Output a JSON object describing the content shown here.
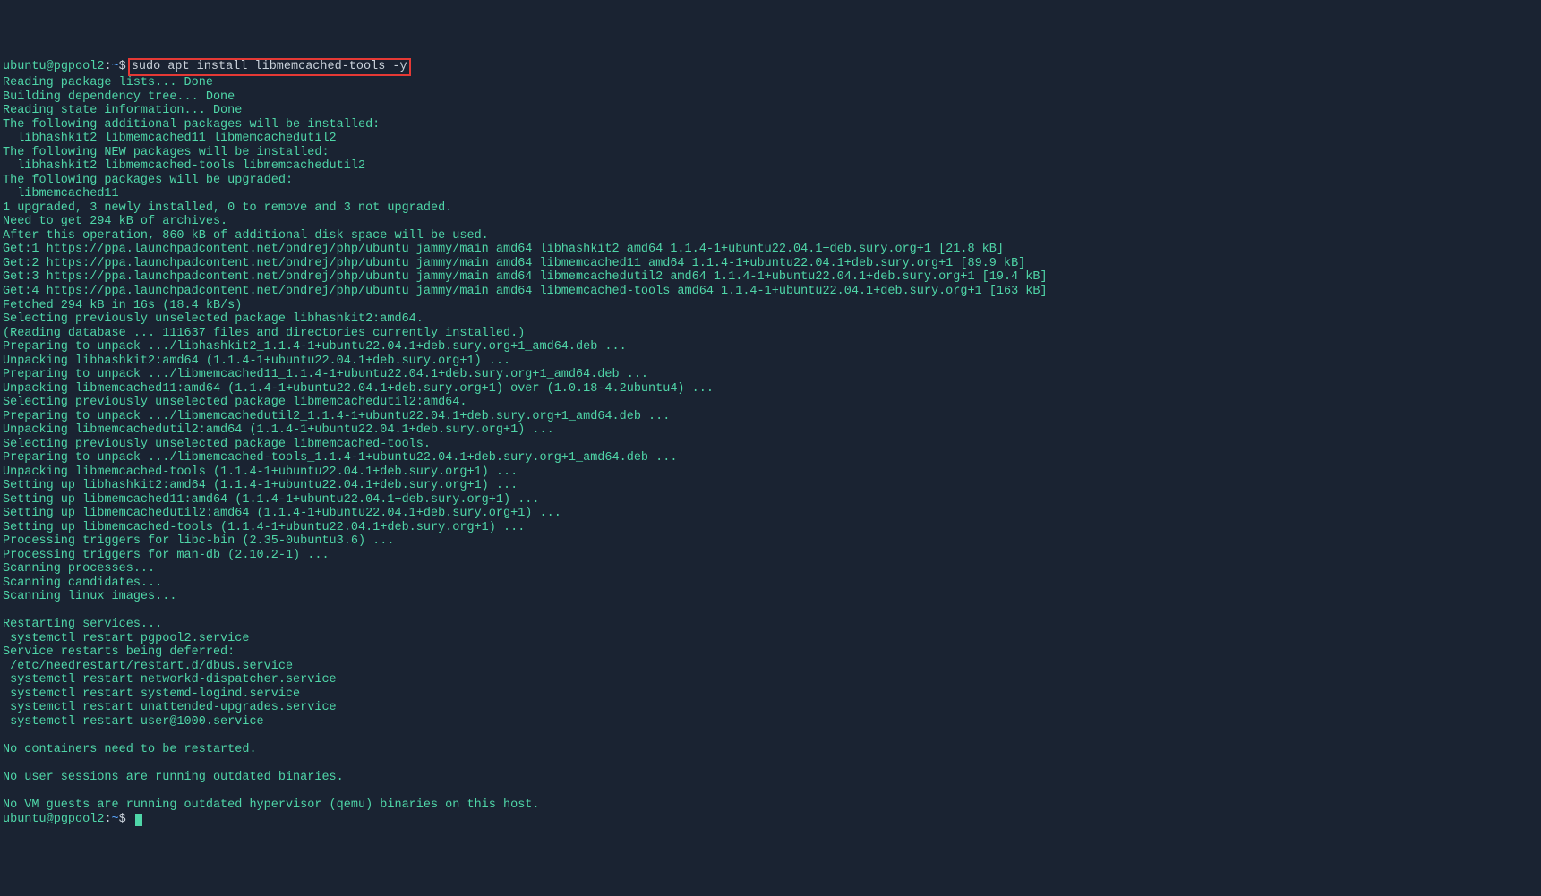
{
  "prompt1": {
    "user": "ubuntu",
    "at": "@",
    "host": "pgpool2",
    "sep": ":",
    "path": "~",
    "dollar": "$",
    "command": "sudo apt install libmemcached-tools -y"
  },
  "lines": [
    "Reading package lists... Done",
    "Building dependency tree... Done",
    "Reading state information... Done",
    "The following additional packages will be installed:",
    "  libhashkit2 libmemcached11 libmemcachedutil2",
    "The following NEW packages will be installed:",
    "  libhashkit2 libmemcached-tools libmemcachedutil2",
    "The following packages will be upgraded:",
    "  libmemcached11",
    "1 upgraded, 3 newly installed, 0 to remove and 3 not upgraded.",
    "Need to get 294 kB of archives.",
    "After this operation, 860 kB of additional disk space will be used.",
    "Get:1 https://ppa.launchpadcontent.net/ondrej/php/ubuntu jammy/main amd64 libhashkit2 amd64 1.1.4-1+ubuntu22.04.1+deb.sury.org+1 [21.8 kB]",
    "Get:2 https://ppa.launchpadcontent.net/ondrej/php/ubuntu jammy/main amd64 libmemcached11 amd64 1.1.4-1+ubuntu22.04.1+deb.sury.org+1 [89.9 kB]",
    "Get:3 https://ppa.launchpadcontent.net/ondrej/php/ubuntu jammy/main amd64 libmemcachedutil2 amd64 1.1.4-1+ubuntu22.04.1+deb.sury.org+1 [19.4 kB]",
    "Get:4 https://ppa.launchpadcontent.net/ondrej/php/ubuntu jammy/main amd64 libmemcached-tools amd64 1.1.4-1+ubuntu22.04.1+deb.sury.org+1 [163 kB]",
    "Fetched 294 kB in 16s (18.4 kB/s)",
    "Selecting previously unselected package libhashkit2:amd64.",
    "(Reading database ... 111637 files and directories currently installed.)",
    "Preparing to unpack .../libhashkit2_1.1.4-1+ubuntu22.04.1+deb.sury.org+1_amd64.deb ...",
    "Unpacking libhashkit2:amd64 (1.1.4-1+ubuntu22.04.1+deb.sury.org+1) ...",
    "Preparing to unpack .../libmemcached11_1.1.4-1+ubuntu22.04.1+deb.sury.org+1_amd64.deb ...",
    "Unpacking libmemcached11:amd64 (1.1.4-1+ubuntu22.04.1+deb.sury.org+1) over (1.0.18-4.2ubuntu4) ...",
    "Selecting previously unselected package libmemcachedutil2:amd64.",
    "Preparing to unpack .../libmemcachedutil2_1.1.4-1+ubuntu22.04.1+deb.sury.org+1_amd64.deb ...",
    "Unpacking libmemcachedutil2:amd64 (1.1.4-1+ubuntu22.04.1+deb.sury.org+1) ...",
    "Selecting previously unselected package libmemcached-tools.",
    "Preparing to unpack .../libmemcached-tools_1.1.4-1+ubuntu22.04.1+deb.sury.org+1_amd64.deb ...",
    "Unpacking libmemcached-tools (1.1.4-1+ubuntu22.04.1+deb.sury.org+1) ...",
    "Setting up libhashkit2:amd64 (1.1.4-1+ubuntu22.04.1+deb.sury.org+1) ...",
    "Setting up libmemcached11:amd64 (1.1.4-1+ubuntu22.04.1+deb.sury.org+1) ...",
    "Setting up libmemcachedutil2:amd64 (1.1.4-1+ubuntu22.04.1+deb.sury.org+1) ...",
    "Setting up libmemcached-tools (1.1.4-1+ubuntu22.04.1+deb.sury.org+1) ...",
    "Processing triggers for libc-bin (2.35-0ubuntu3.6) ...",
    "Processing triggers for man-db (2.10.2-1) ...",
    "Scanning processes...",
    "Scanning candidates...",
    "Scanning linux images...",
    "",
    "Restarting services...",
    " systemctl restart pgpool2.service",
    "Service restarts being deferred:",
    " /etc/needrestart/restart.d/dbus.service",
    " systemctl restart networkd-dispatcher.service",
    " systemctl restart systemd-logind.service",
    " systemctl restart unattended-upgrades.service",
    " systemctl restart user@1000.service",
    "",
    "No containers need to be restarted.",
    "",
    "No user sessions are running outdated binaries.",
    "",
    "No VM guests are running outdated hypervisor (qemu) binaries on this host."
  ],
  "prompt2": {
    "user": "ubuntu",
    "at": "@",
    "host": "pgpool2",
    "sep": ":",
    "path": "~",
    "dollar": "$"
  }
}
